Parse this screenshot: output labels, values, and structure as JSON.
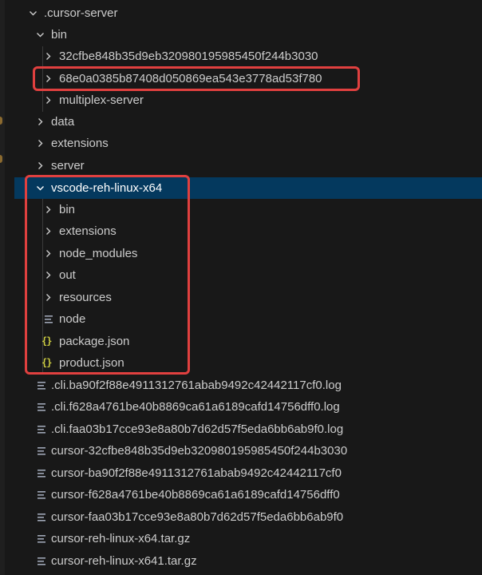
{
  "tree": {
    "root_folder": ".cursor-server",
    "bin_folder": "bin",
    "bin_children": [
      "32cfbe848b35d9eb320980195985450f244b3030",
      "68e0a0385b87408d050869ea543e3778ad53f780",
      "multiplex-server"
    ],
    "folders": [
      "data",
      "extensions",
      "server"
    ],
    "selected_folder": "vscode-reh-linux-x64",
    "vscode_subfolders": [
      "bin",
      "extensions",
      "node_modules",
      "out",
      "resources"
    ],
    "vscode_files": [
      "node",
      "package.json",
      "product.json"
    ],
    "root_files": [
      ".cli.ba90f2f88e4911312761abab9492c42442117cf0.log",
      ".cli.f628a4761be40b8869ca61a6189cafd14756dff0.log",
      ".cli.faa03b17cce93e8a80b7d62d57f5eda6bb6ab9f0.log",
      "cursor-32cfbe848b35d9eb320980195985450f244b3030",
      "cursor-ba90f2f88e4911312761abab9492c42442117cf0",
      "cursor-f628a4761be40b8869ca61a6189cafd14756dff0",
      "cursor-faa03b17cce93e8a80b7d62d57f5eda6bb6ab9f0",
      "cursor-reh-linux-x64.tar.gz",
      "cursor-reh-linux-x641.tar.gz"
    ]
  },
  "icons": {
    "chevron": "chevron-icon",
    "file": "file-lines-icon",
    "json": "json-braces-icon",
    "json_glyph": "{}"
  },
  "colors": {
    "background": "#181818",
    "selected_row": "#04395e",
    "highlight_box": "#e0403f",
    "json_icon": "#cbcb41",
    "text": "#cccccc"
  }
}
